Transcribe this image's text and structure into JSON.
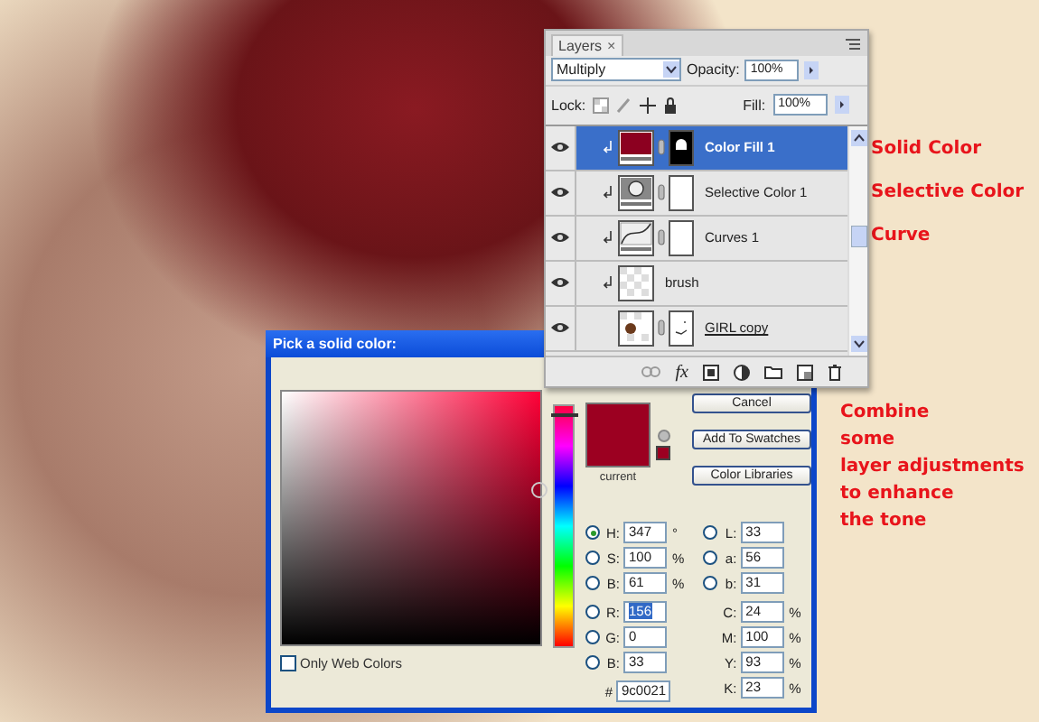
{
  "layers_panel": {
    "tab": "Layers",
    "tab_close": "×",
    "blend_mode": "Multiply",
    "opacity_label": "Opacity:",
    "opacity": "100%",
    "lock_label": "Lock:",
    "fill_label": "Fill:",
    "fill": "100%",
    "fx": "fx",
    "layers": [
      {
        "name": "Color Fill 1",
        "kind": "fill",
        "clipped": true,
        "visible": true,
        "selected": true,
        "underlined": false
      },
      {
        "name": "Selective Color 1",
        "kind": "selective",
        "clipped": true,
        "visible": true,
        "selected": false,
        "underlined": false
      },
      {
        "name": "Curves 1",
        "kind": "curves",
        "clipped": true,
        "visible": true,
        "selected": false,
        "underlined": false
      },
      {
        "name": "brush",
        "kind": "pixel",
        "clipped": true,
        "visible": true,
        "selected": false,
        "underlined": false
      },
      {
        "name": "GIRL copy",
        "kind": "smart",
        "clipped": false,
        "visible": true,
        "selected": false,
        "underlined": true
      }
    ]
  },
  "color_picker": {
    "title": "Pick a solid color:",
    "current_label": "current",
    "buttons": [
      "Cancel",
      "Add To Swatches",
      "Color Libraries"
    ],
    "hue_slider": {
      "level": 0.96
    },
    "only_web_colors": {
      "label": "Only Web Colors",
      "checked": false
    },
    "hsb": [
      {
        "label": "H:",
        "value": "347",
        "unit": "°",
        "selected": true
      },
      {
        "label": "S:",
        "value": "100",
        "unit": "%",
        "selected": false
      },
      {
        "label": "B:",
        "value": "61",
        "unit": "%",
        "selected": false
      }
    ],
    "rgb": [
      {
        "label": "R:",
        "value": "156",
        "selected": false,
        "highlighted": true
      },
      {
        "label": "G:",
        "value": "0",
        "selected": false,
        "highlighted": false
      },
      {
        "label": "B:",
        "value": "33",
        "selected": false,
        "highlighted": false
      }
    ],
    "lab": [
      {
        "label": "L:",
        "value": "33",
        "selected": false
      },
      {
        "label": "a:",
        "value": "56",
        "selected": false
      },
      {
        "label": "b:",
        "value": "31",
        "selected": false
      }
    ],
    "cmyk": [
      {
        "label": "C:",
        "value": "24",
        "unit": "%"
      },
      {
        "label": "M:",
        "value": "100",
        "unit": "%"
      },
      {
        "label": "Y:",
        "value": "93",
        "unit": "%"
      },
      {
        "label": "K:",
        "value": "23",
        "unit": "%"
      }
    ],
    "hex": {
      "label": "#",
      "value": "9c0021"
    }
  },
  "callouts": [
    "Solid Color",
    "Selective Color",
    "Curve"
  ],
  "note_lines": [
    "Combine",
    "some",
    "layer adjustments",
    "to enhance",
    "the tone"
  ]
}
